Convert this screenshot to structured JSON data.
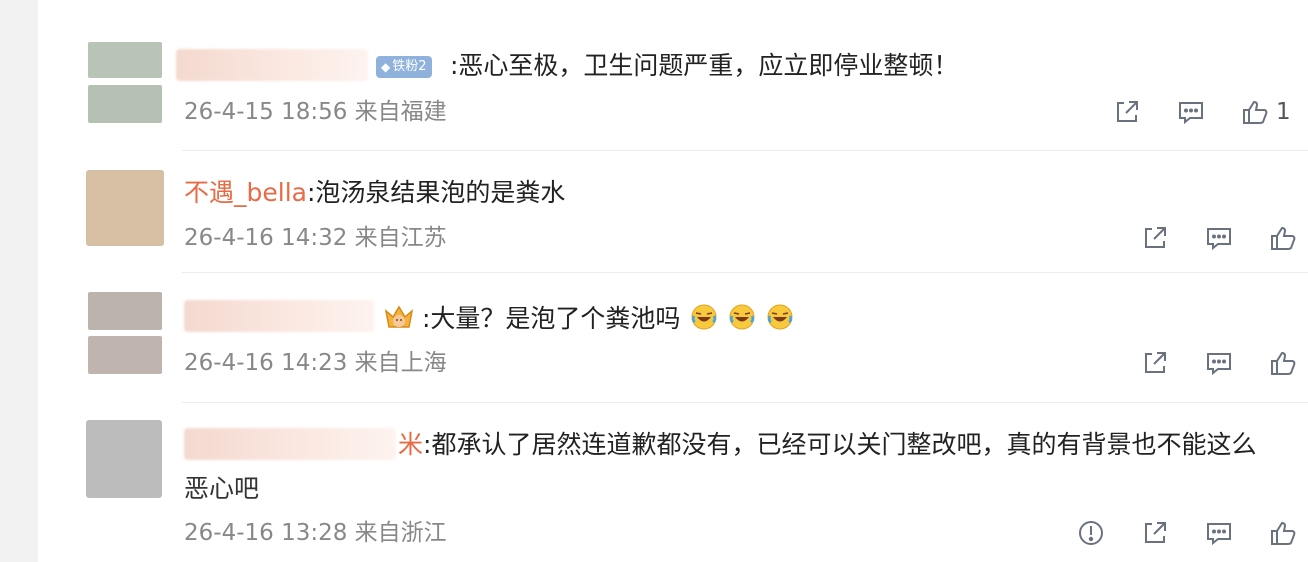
{
  "colors": {
    "username": "#e86b45",
    "meta": "#888888",
    "icon": "#6a7280",
    "badge": "#8fb2dd"
  },
  "comments": [
    {
      "badge_label": "铁粉2",
      "text": ":恶心至极，卫生问题严重，应立即停业整顿！",
      "time": "26-4-15 18:56",
      "location": "来自福建",
      "likes": "1"
    },
    {
      "username": "不遇_bella",
      "text": ":泡汤泉结果泡的是粪水",
      "time": "26-4-16 14:32",
      "location": "来自江苏"
    },
    {
      "text": ":大量？是泡了个粪池吗",
      "time": "26-4-16 14:23",
      "location": "来自上海",
      "emojis": [
        "laugh-cry-emoji",
        "laugh-cry-emoji",
        "laugh-cry-emoji"
      ]
    },
    {
      "username_suffix": "米",
      "text": ":都承认了居然连道歉都没有，已经可以关门整改吧，真的有背景也不能这么",
      "text_line2": "恶心吧",
      "time": "26-4-16 13:28",
      "location": "来自浙江"
    }
  ],
  "icons": {
    "share": "share-icon",
    "reply": "comment-icon",
    "like": "thumbs-up-icon",
    "report": "report-icon"
  }
}
